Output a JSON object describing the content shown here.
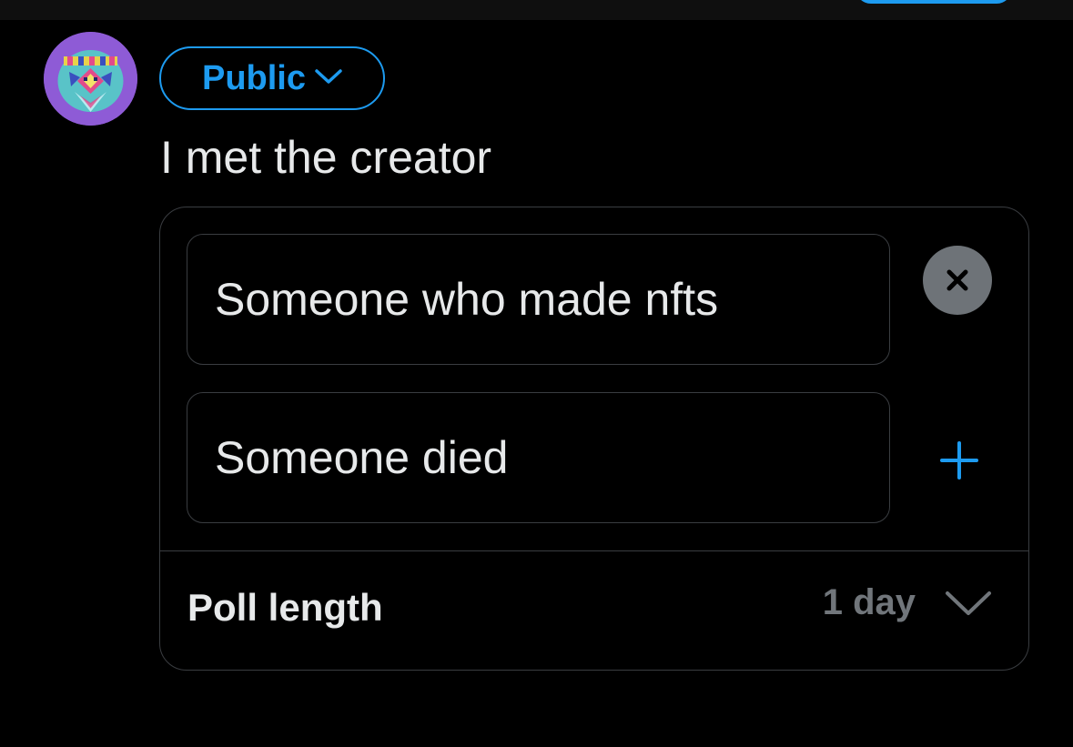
{
  "composer": {
    "audience_label": "Public",
    "tweet_text": "I met the creator"
  },
  "poll": {
    "choices": [
      {
        "text": "Someone who made nfts"
      },
      {
        "text": "Someone died"
      }
    ],
    "length_label": "Poll length",
    "length_value": "1 day"
  },
  "icons": {
    "audience_chevron": "chevron-down-icon",
    "remove_choice": "close-icon",
    "add_choice": "plus-icon",
    "poll_length_chevron": "chevron-down-icon"
  },
  "colors": {
    "background": "#000000",
    "accent": "#1d9bf0",
    "text_primary": "#e7e9ea",
    "text_secondary": "#71767b",
    "border": "#3a3d41",
    "avatar_bg": "#8e5bd6"
  }
}
